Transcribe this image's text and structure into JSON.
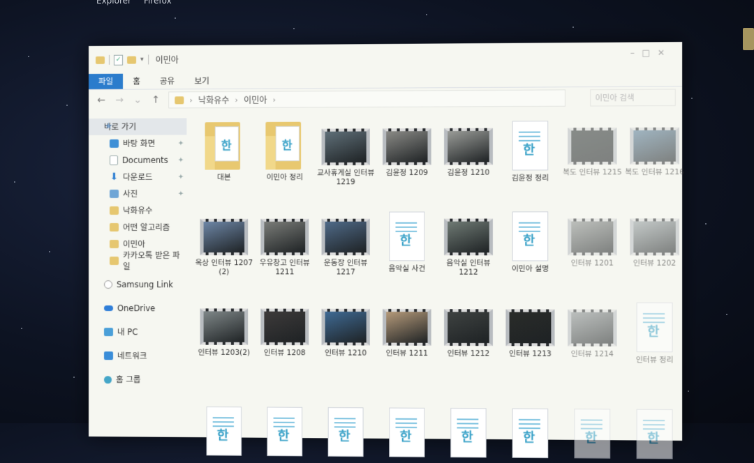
{
  "desktop": {
    "labels": [
      "Explorer",
      "Firefox"
    ]
  },
  "window": {
    "title": "이민아",
    "ribbon_tabs": [
      "파일",
      "홈",
      "공유",
      "보기"
    ],
    "breadcrumb": [
      "낙화유수",
      "이민아"
    ],
    "search_placeholder": "이민아 검색"
  },
  "sidebar": {
    "items": [
      {
        "label": "바로 가기",
        "icon": "star-icon"
      },
      {
        "label": "바탕 화면",
        "icon": "desktop-icon"
      },
      {
        "label": "Documents",
        "icon": "documents-icon"
      },
      {
        "label": "다운로드",
        "icon": "download-icon"
      },
      {
        "label": "사진",
        "icon": "pictures-icon"
      },
      {
        "label": "낙화유수",
        "icon": "folder-icon"
      },
      {
        "label": "어떤 알고리즘",
        "icon": "folder-icon"
      },
      {
        "label": "이민아",
        "icon": "folder-icon"
      },
      {
        "label": "카카오톡 받은 파일",
        "icon": "folder-icon"
      },
      {
        "label": "Samsung Link",
        "icon": "link-icon"
      },
      {
        "label": "OneDrive",
        "icon": "onedrive-icon"
      },
      {
        "label": "내 PC",
        "icon": "pc-icon"
      },
      {
        "label": "네트워크",
        "icon": "network-icon"
      },
      {
        "label": "홈 그룹",
        "icon": "homegroup-icon"
      }
    ]
  },
  "files": [
    {
      "name": "대본",
      "kind": "folder"
    },
    {
      "name": "이민아 정리",
      "kind": "folder"
    },
    {
      "name": "교사휴게실 인터뷰 1219",
      "kind": "video",
      "tone": "#5f6f78"
    },
    {
      "name": "김윤정 1209",
      "kind": "video",
      "tone": "#8a8a86"
    },
    {
      "name": "김윤정 1210",
      "kind": "video",
      "tone": "#9a9c98"
    },
    {
      "name": "김윤정 정리",
      "kind": "doc"
    },
    {
      "name": "복도 인터뷰 1215",
      "kind": "video",
      "tone": "#2d3433"
    },
    {
      "name": "복도 인터뷰 1216",
      "kind": "video",
      "tone": "#5a7f9a"
    },
    {
      "name": "옥상 인터뷰 1207 (2)",
      "kind": "video",
      "tone": "#6d86a6"
    },
    {
      "name": "우유창고 인터뷰 1211",
      "kind": "video",
      "tone": "#7a7c78"
    },
    {
      "name": "운동장 인터뷰 1217",
      "kind": "video",
      "tone": "#4f6a88"
    },
    {
      "name": "음악실 사건",
      "kind": "doc"
    },
    {
      "name": "음악실 인터뷰 1212",
      "kind": "video",
      "tone": "#6f7a74"
    },
    {
      "name": "이민아 설명",
      "kind": "doc"
    },
    {
      "name": "인터뷰 1201",
      "kind": "video",
      "tone": "#8e9290"
    },
    {
      "name": "인터뷰 1202",
      "kind": "video",
      "tone": "#9aa3a6"
    },
    {
      "name": "인터뷰 1203(2)",
      "kind": "video",
      "tone": "#7f8788"
    },
    {
      "name": "인터뷰 1208",
      "kind": "video",
      "tone": "#3d3a3a"
    },
    {
      "name": "인터뷰 1210",
      "kind": "video",
      "tone": "#3f6a94"
    },
    {
      "name": "인터뷰 1211",
      "kind": "video",
      "tone": "#b59a7a"
    },
    {
      "name": "인터뷰 1212",
      "kind": "video",
      "tone": "#3e4241"
    },
    {
      "name": "인터뷰 1213",
      "kind": "video",
      "tone": "#2a2c2a"
    },
    {
      "name": "인터뷰 1214",
      "kind": "video",
      "tone": "#8c9294"
    },
    {
      "name": "인터뷰 정리",
      "kind": "doc"
    }
  ],
  "bottom_docs": [
    "",
    "",
    "",
    "",
    "",
    "",
    "",
    ""
  ]
}
